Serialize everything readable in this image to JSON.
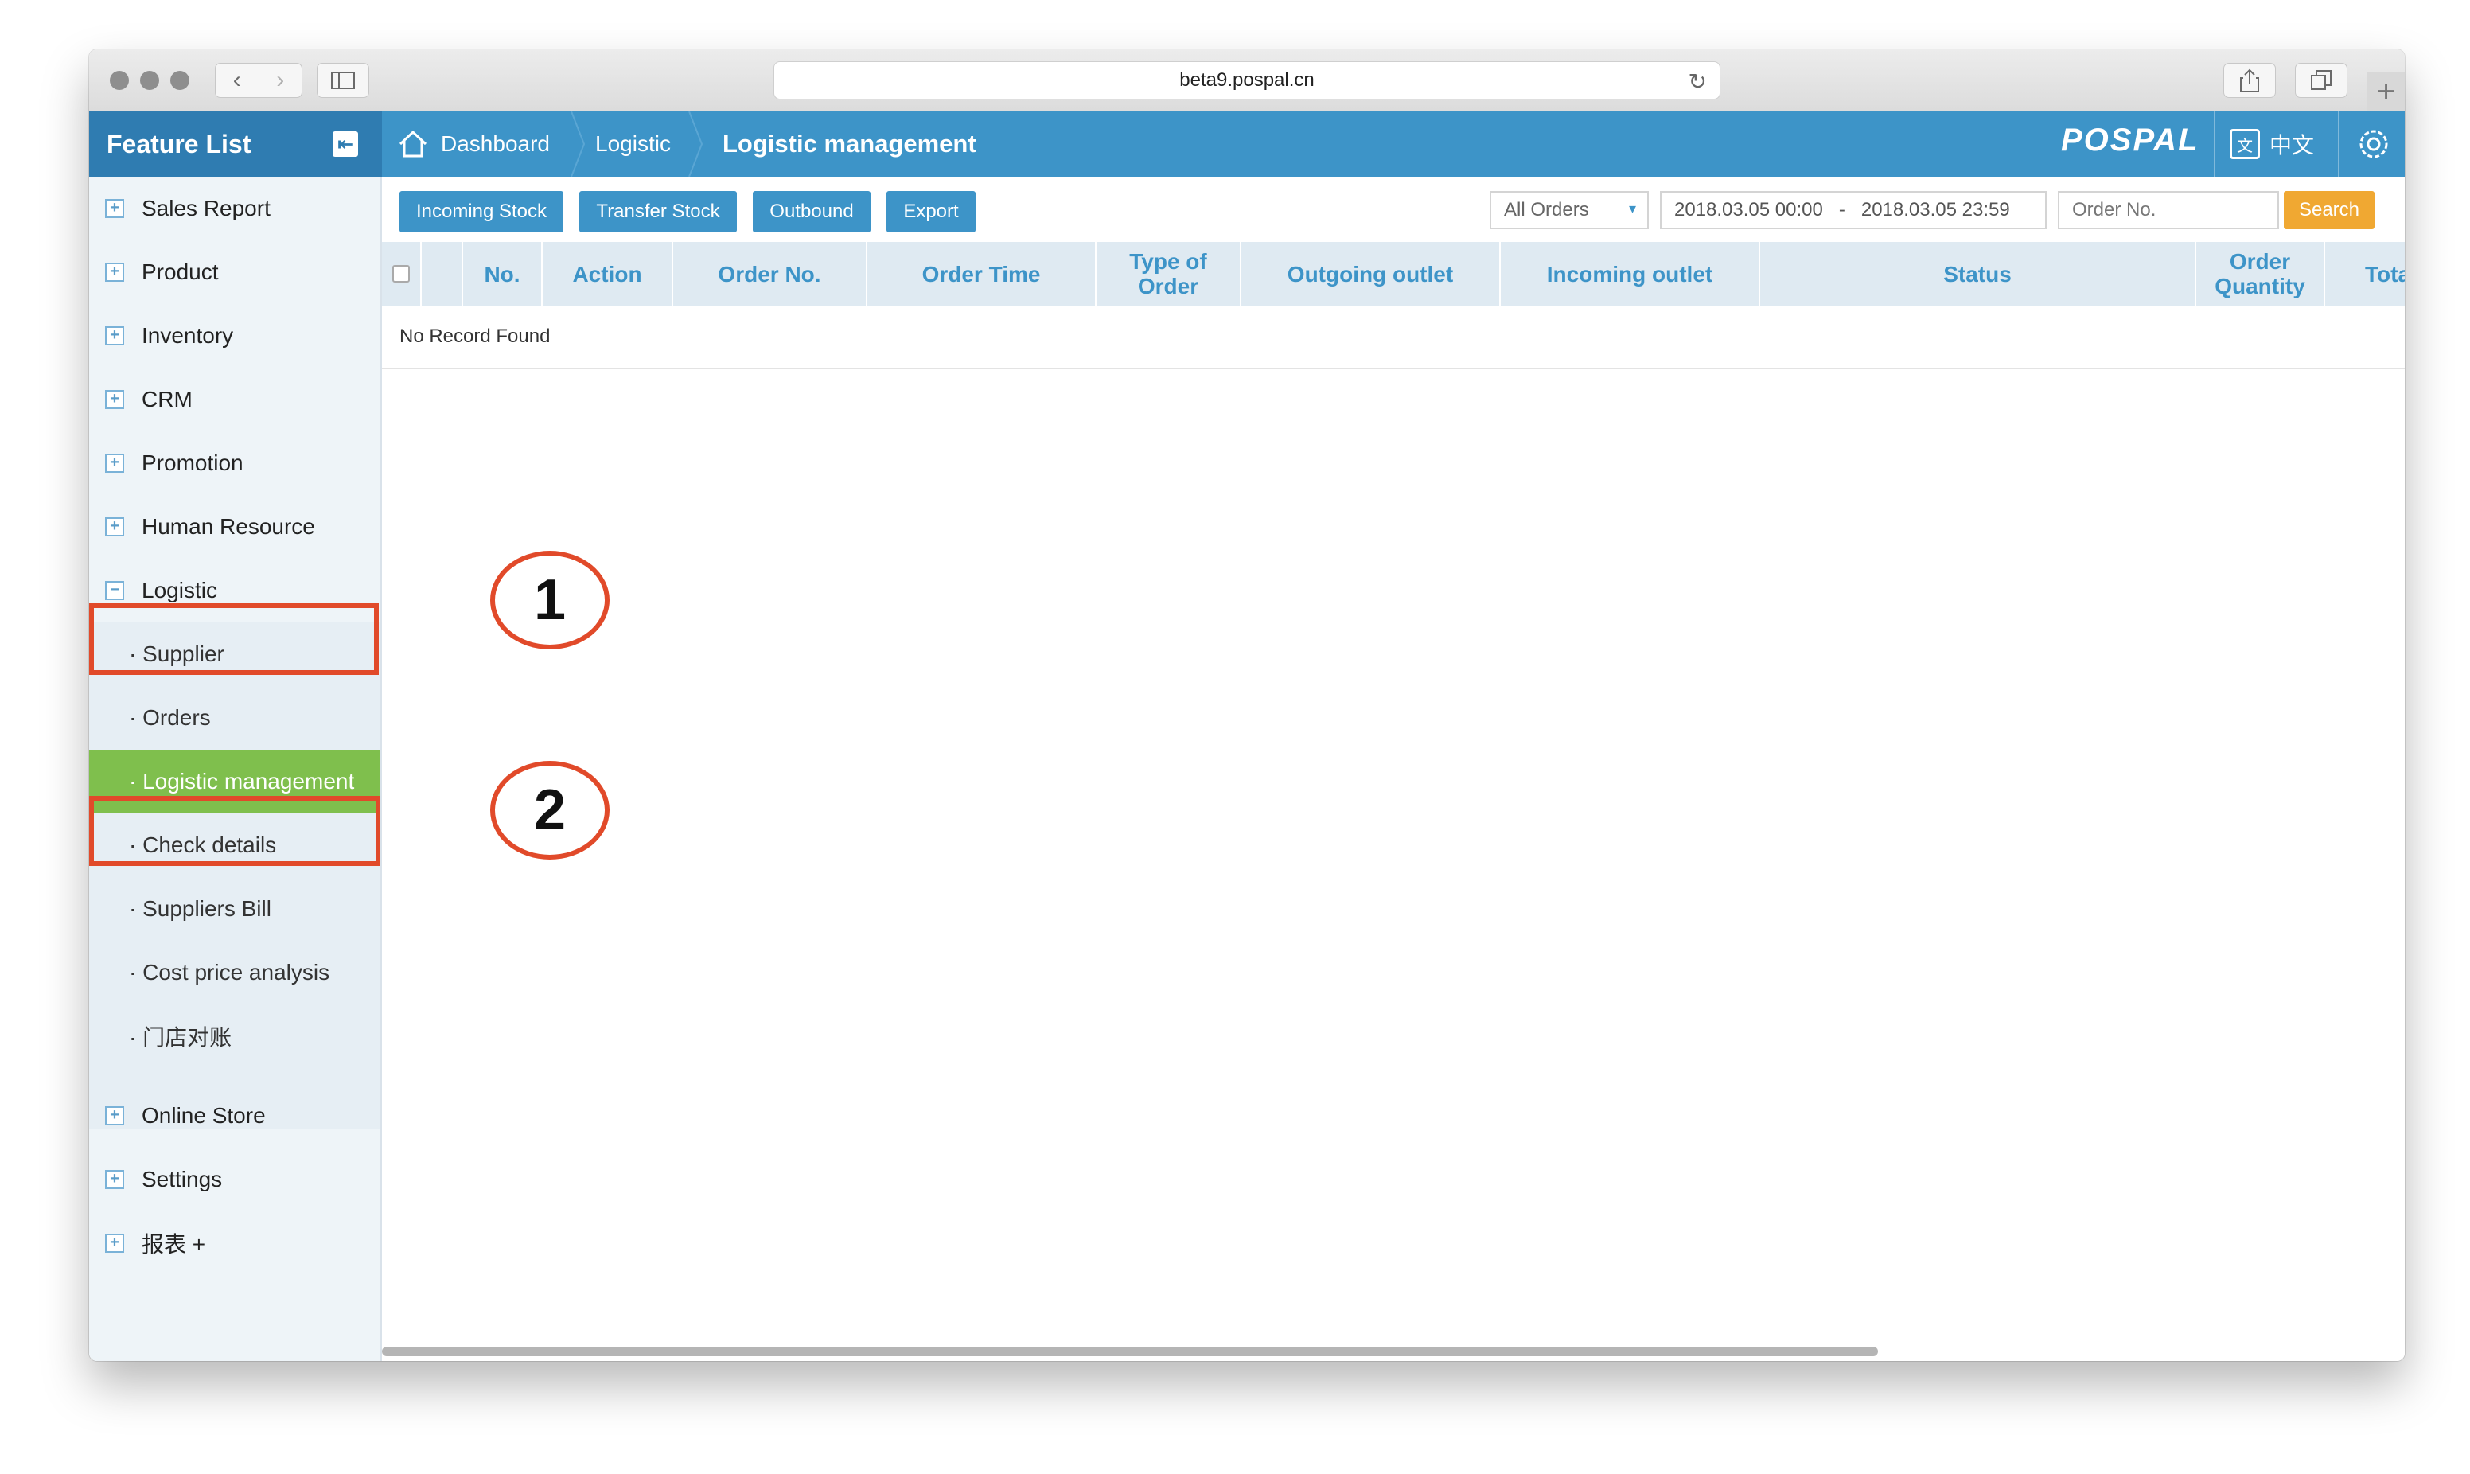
{
  "browser": {
    "url": "beta9.pospal.cn"
  },
  "header": {
    "feature_list": "Feature List",
    "breadcrumbs": [
      "Dashboard",
      "Logistic",
      "Logistic management"
    ],
    "logo": "POSPAL",
    "language": "中文"
  },
  "sidebar": {
    "items": [
      {
        "label": "Sales Report",
        "expanded": false
      },
      {
        "label": "Product",
        "expanded": false
      },
      {
        "label": "Inventory",
        "expanded": false
      },
      {
        "label": "CRM",
        "expanded": false
      },
      {
        "label": "Promotion",
        "expanded": false
      },
      {
        "label": "Human Resource",
        "expanded": false
      },
      {
        "label": "Logistic",
        "expanded": true
      },
      {
        "label": "Online Store",
        "expanded": false
      },
      {
        "label": "Settings",
        "expanded": false
      },
      {
        "label": "报表 +",
        "expanded": false
      }
    ],
    "logistic_sub": [
      "· Supplier",
      "· Orders",
      "· Logistic management",
      "· Check details",
      "· Suppliers Bill",
      "· Cost price analysis",
      "· 门店对账"
    ],
    "active_sub": "· Logistic management"
  },
  "toolbar": {
    "buttons": [
      "Incoming Stock",
      "Transfer Stock",
      "Outbound",
      "Export"
    ],
    "order_filter": "All Orders",
    "date_start": "2018.03.05 00:00",
    "date_sep": "-",
    "date_end": "2018.03.05 23:59",
    "order_no_placeholder": "Order No.",
    "search": "Search"
  },
  "table": {
    "columns": [
      "No.",
      "Action",
      "Order No.",
      "Order Time",
      "Type of Order",
      "Outgoing outlet",
      "Incoming outlet",
      "Status",
      "Order Quantity",
      "Tota"
    ],
    "empty_text": "No Record Found"
  },
  "annotations": [
    "1",
    "2"
  ],
  "colors": {
    "brand_blue": "#3d94c8",
    "active_green": "#7fbf4d",
    "search_orange": "#f0a832",
    "highlight_red": "#e14a2a"
  }
}
